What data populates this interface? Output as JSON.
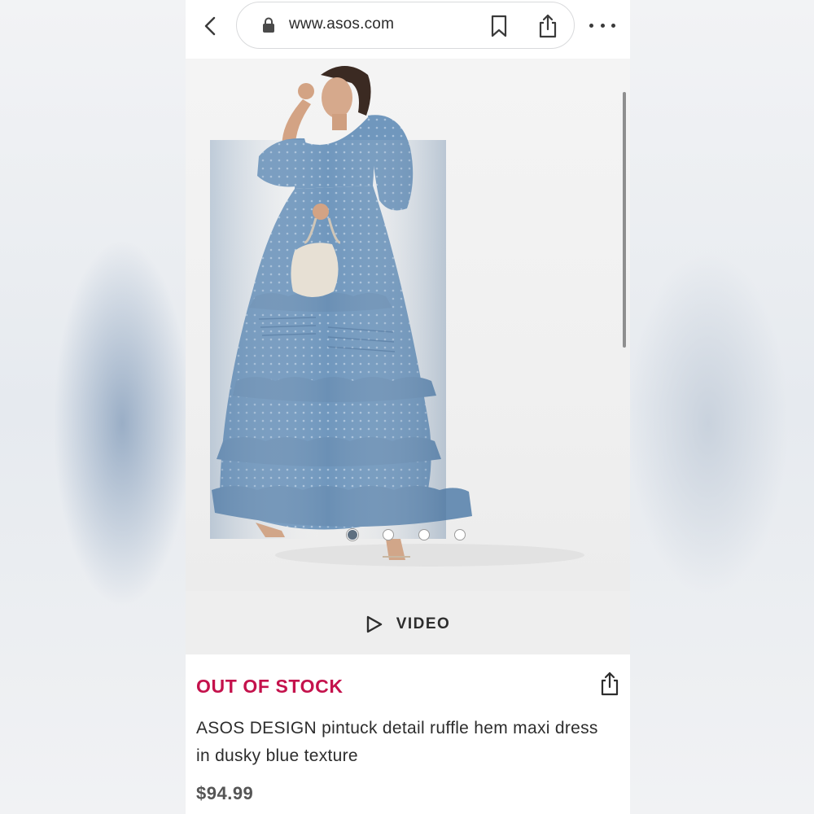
{
  "browser": {
    "url": "www.asos.com",
    "icons": {
      "back": "chevron-left-icon",
      "lock": "lock-icon",
      "bookmark": "bookmark-icon",
      "share": "share-icon",
      "more": "more-horizontal-icon"
    }
  },
  "gallery": {
    "image_description": "Model wearing tiered ruffle maxi dress in dusky blue",
    "pagination": {
      "total": 4,
      "active_index": 0
    }
  },
  "video": {
    "label": "VIDEO",
    "icon": "play-outline-icon"
  },
  "product": {
    "stock_status": "OUT OF STOCK",
    "title": "ASOS DESIGN pintuck detail ruffle hem maxi dress in dusky blue texture",
    "price": "$94.99",
    "share_icon": "share-icon"
  },
  "colors": {
    "stock_status": "#c4124c",
    "dress": "#6f93b8",
    "page_background": "#ffffff"
  }
}
